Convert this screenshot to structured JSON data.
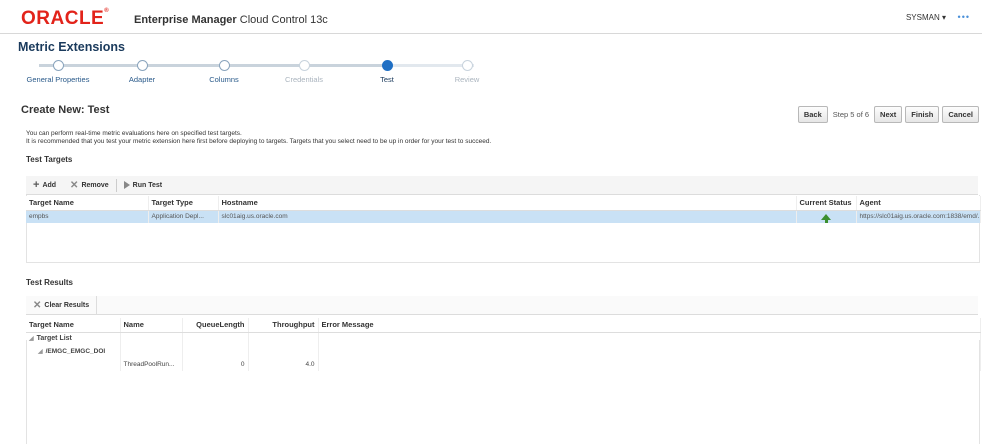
{
  "header": {
    "brand": "ORACLE",
    "product_bold": "Enterprise Manager",
    "product_rest": " Cloud Control 13c",
    "user": "SYSMAN ▾",
    "more": "•••"
  },
  "page_title": "Metric Extensions",
  "train": {
    "steps": [
      {
        "label": "General Properties",
        "state": "visited"
      },
      {
        "label": "Adapter",
        "state": "visited"
      },
      {
        "label": "Columns",
        "state": "visited"
      },
      {
        "label": "Credentials",
        "state": "disabled"
      },
      {
        "label": "Test",
        "state": "current"
      },
      {
        "label": "Review",
        "state": "disabled"
      }
    ]
  },
  "sub_title": "Create New: Test",
  "nav": {
    "back": "Back",
    "step_text": "Step 5 of 6",
    "next": "Next",
    "finish": "Finish",
    "cancel": "Cancel"
  },
  "description": {
    "line1": "You can perform real-time metric evaluations here on specified test targets.",
    "line2": "It is recommended that you test your metric extension here first before deploying to targets. Targets that you select need to be up in order for your test to succeed."
  },
  "test_targets": {
    "heading": "Test Targets",
    "toolbar": {
      "add": "Add",
      "remove": "Remove",
      "run_test": "Run Test"
    },
    "columns": [
      "Target Name",
      "Target Type",
      "Hostname",
      "Current Status",
      "Agent"
    ],
    "rows": [
      {
        "target_name": "empbs",
        "target_type": "Application Depl...",
        "hostname": "slc01aig.us.oracle.com",
        "status": "up",
        "agent": "https://slc01aig.us.oracle.com:1838/emd/..."
      }
    ]
  },
  "test_results": {
    "heading": "Test Results",
    "toolbar": {
      "clear": "Clear Results"
    },
    "columns": [
      "Target Name",
      "Name",
      "QueueLength",
      "Throughput",
      "Error Message"
    ],
    "rows": [
      {
        "target_name": "Target List",
        "name": "",
        "queue_length": "",
        "throughput": "",
        "error": ""
      },
      {
        "target_name": "/EMGC_EMGC_DOI",
        "name": "",
        "queue_length": "",
        "throughput": "",
        "error": ""
      },
      {
        "target_name": "",
        "name": "ThreadPoolRun...",
        "queue_length": "0",
        "throughput": "4.0",
        "error": ""
      }
    ]
  }
}
